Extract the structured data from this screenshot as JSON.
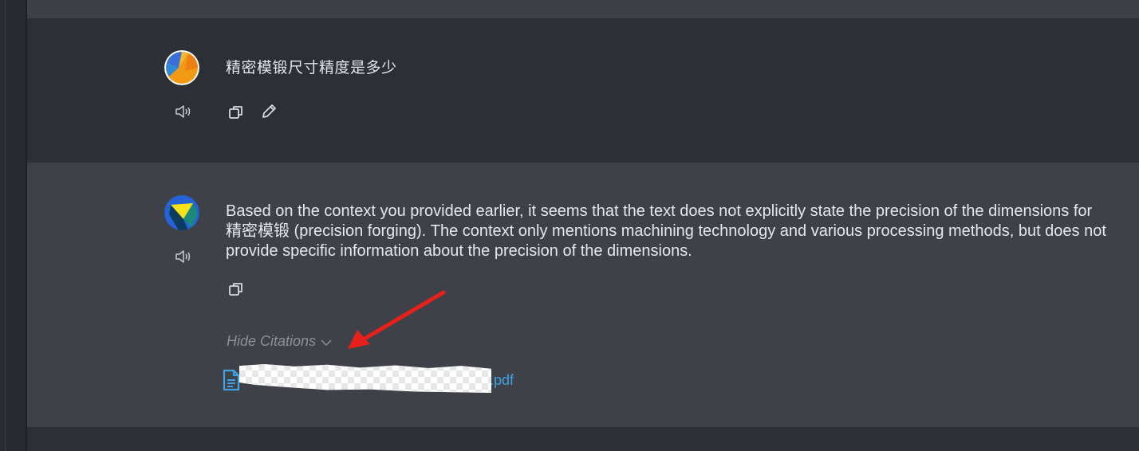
{
  "conversation": {
    "user_message": {
      "text": "精密模锻尺寸精度是多少"
    },
    "assistant_message": {
      "text": "Based on the context you provided earlier, it seems that the text does not explicitly state the precision of the dimensions for 精密模锻 (precision forging). The context only mentions machining technology and various processing methods, but does not provide specific information about the precision of the dimensions.",
      "citations_toggle_label": "Hide Citations",
      "citations": [
        {
          "file_name_suffix": ".pdf",
          "icon": "document-icon"
        }
      ]
    }
  },
  "icons": {
    "user_avatar": "user-avatar",
    "assistant_avatar": "assistant-avatar",
    "speaker": "speaker-icon",
    "copy": "copy-icon",
    "edit": "pencil-icon",
    "chevron": "chevron-down-icon"
  },
  "colors": {
    "user_block_bg": "#2d2f36",
    "assistant_block_bg": "#3f4149",
    "link": "#3fa2e6",
    "annotation_arrow": "#e8201a"
  }
}
